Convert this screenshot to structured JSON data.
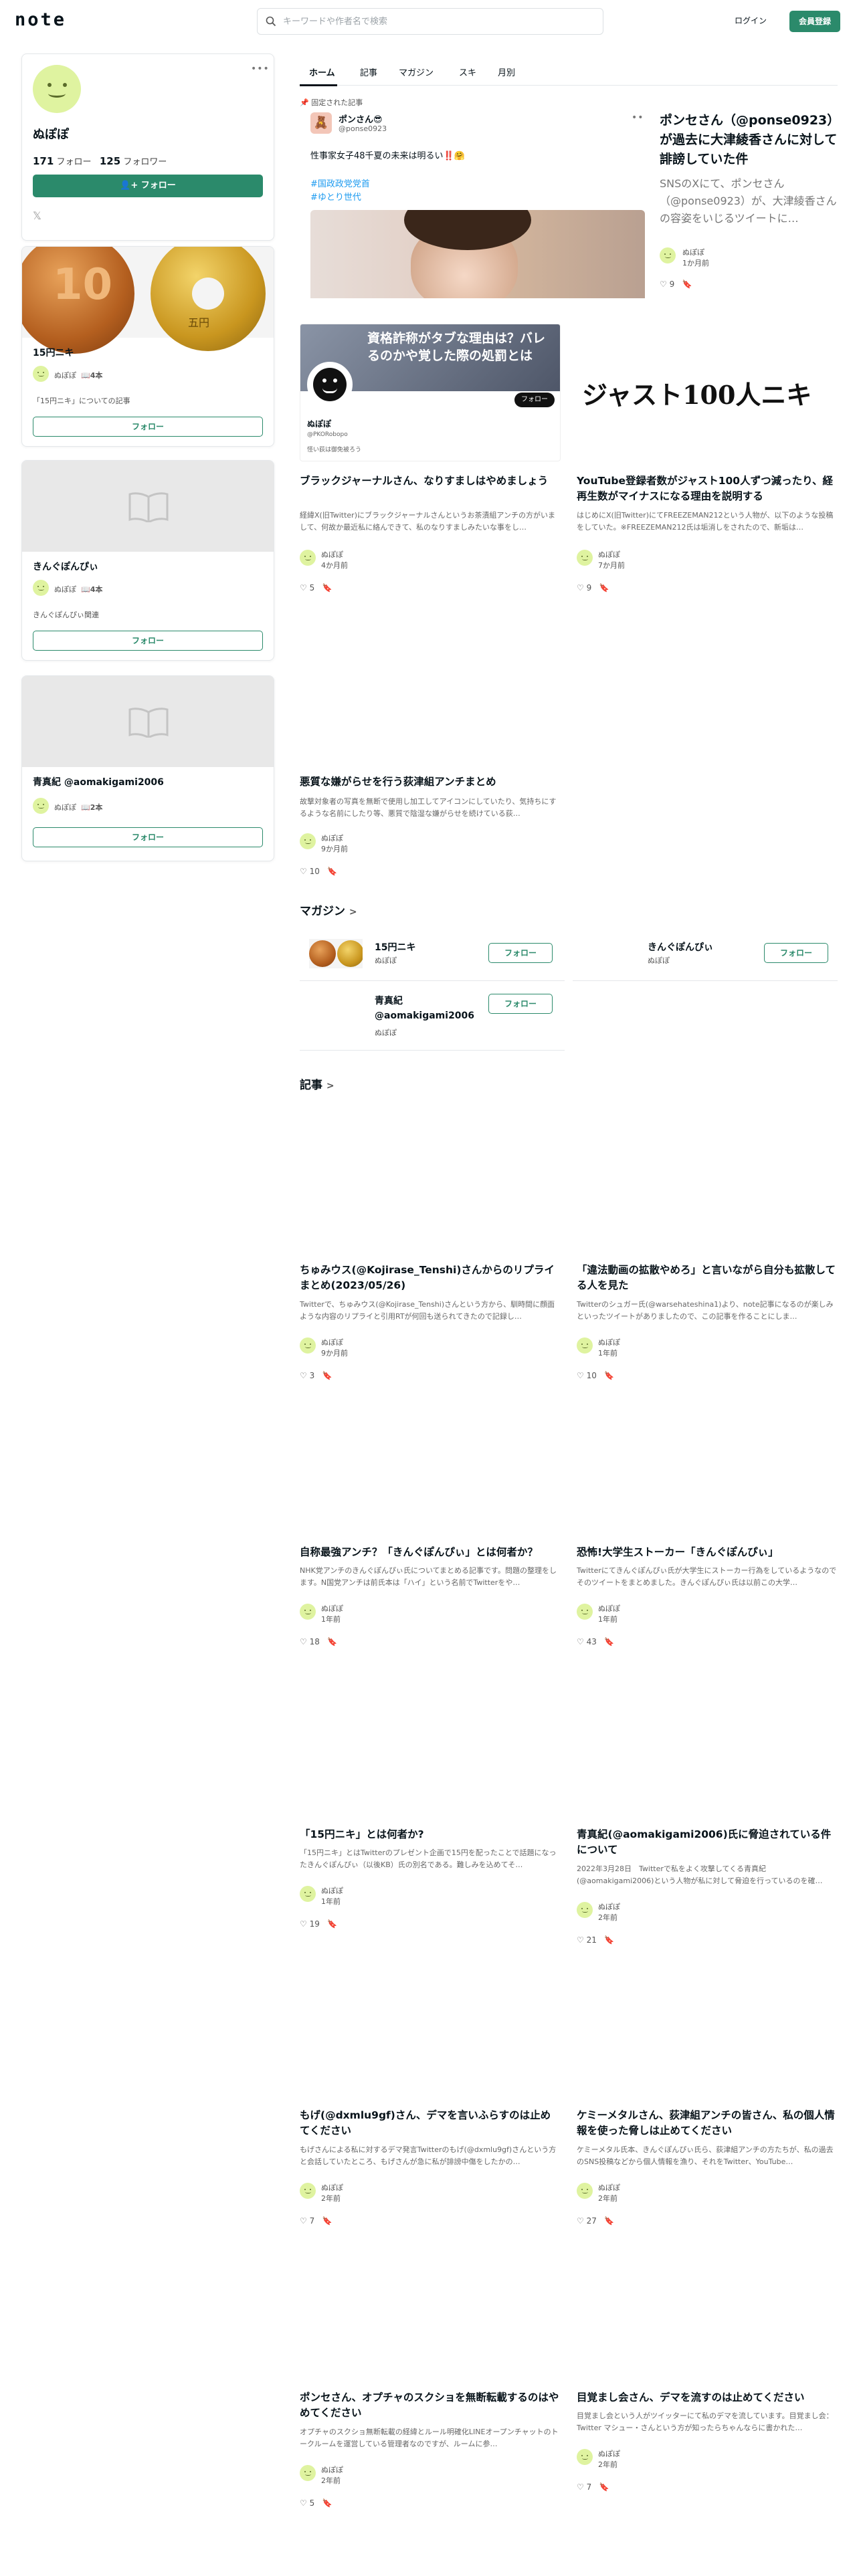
{
  "header": {
    "logo": "note",
    "search_placeholder": "キーワードや作者名で検索",
    "login": "ログイン",
    "signup": "会員登録"
  },
  "profile": {
    "name": "ぬぽぽ",
    "following_count": "171",
    "following_label": "フォロー",
    "followers_count": "125",
    "followers_label": "フォロワー",
    "follow_button": "フォロー"
  },
  "sidebar_magazines": [
    {
      "title": "15円ニキ",
      "author": "ぬぽぽ",
      "count": "4本",
      "description": "「15円ニキ」についての記事",
      "follow": "フォロー"
    },
    {
      "title": "きんぐぽんぴぃ",
      "author": "ぬぽぽ",
      "count": "4本",
      "description": "きんぐぽんぴぃ関連",
      "follow": "フォロー"
    },
    {
      "title": "青真紀 @aomakigami2006",
      "author": "ぬぽぽ",
      "count": "2本",
      "description": "",
      "follow": "フォロー"
    }
  ],
  "tabs": [
    "ホーム",
    "記事",
    "マガジン",
    "スキ",
    "月別"
  ],
  "pinned": {
    "label": "固定された記事",
    "embed_user": "ポンさん😎",
    "embed_handle": "@ponse0923",
    "embed_text": "性事家女子48千夏の未来は明るい‼️🤗",
    "embed_tags": [
      "#国政政党党首",
      "#ゆとり世代"
    ],
    "title": "ポンセさん（@ponse0923）が過去に大津綾香さんに対して誹謗していた件",
    "desc": "SNSのXにて、ポンセさん（@ponse0923）が、大津綾香さんの容姿をいじるツイートに…",
    "author": "ぬぽぽ",
    "time": "1か月前",
    "likes": "9"
  },
  "featured": [
    {
      "title": "ブラックジャーナルさん、なりすましはやめましょう",
      "desc": "経緯X(旧Twitter)にブラックジャーナルさんというお茶漬組アンチの方がいまして、何故か最近私に絡んできて、私のなりすましみたいな事をし…",
      "author": "ぬぽぽ",
      "time": "4か月前",
      "likes": "5",
      "thumb_text": "資格詐称がタブな理由は？バレるのかや覚した際の処罰とは",
      "thumb_name": "ぬぽぽ",
      "thumb_handle": "@PKORobopo",
      "thumb_bio": "怪い荻は御免被ろう",
      "thumb_follow": "フォロー"
    },
    {
      "title": "YouTube登録者数がジャスト100人ずつ減ったり、経再生数がマイナスになる理由を説明する",
      "desc": "はじめにX(旧Twitter)にてFREEZEMAN212という人物が、以下のような投稿をしていた。※FREEZEMAN212氏は垢消しをされたので、新垢は…",
      "author": "ぬぽぽ",
      "time": "7か月前",
      "likes": "9",
      "thumb_text": "ジャスト100人ニキ"
    },
    {
      "title": "悪質な嫌がらせを行う荻津組アンチまとめ",
      "desc": "故撃対象者の写真を無断で使用し加工してアイコンにしていたり、気持ちにするような名前にしたり等、悪質で陰湿な嫌がらせを続けている荻…",
      "author": "ぬぽぽ",
      "time": "9か月前",
      "likes": "10"
    }
  ],
  "magazine_section": {
    "heading": "マガジン",
    "items": [
      {
        "title": "15円ニキ",
        "author": "ぬぽぽ",
        "follow": "フォロー"
      },
      {
        "title": "きんぐぽんぴぃ",
        "author": "ぬぽぽ",
        "follow": "フォロー"
      },
      {
        "title": "青真紀 @aomakigami2006",
        "author": "ぬぽぽ",
        "follow": "フォロー"
      }
    ]
  },
  "articles_section": {
    "heading": "記事",
    "items": [
      {
        "title": "ちゅみウス(@Kojirase_Tenshi)さんからのリプライまとめ(2023/05/26)",
        "desc": "Twitterで、ちゅみウス(@Kojirase_Tenshi)さんという方から、馴時間に顔面ような内容のリプライと引用RTが何回も送られてきたので記録し…",
        "author": "ぬぽぽ",
        "time": "9か月前",
        "likes": "3"
      },
      {
        "title": "「違法動画の拡散やめろ」と言いながら自分も拡散してる人を見た",
        "desc": "Twitterのシュガー氏(@warsehateshina1)より、note記事になるのが楽しみといったツイートがありましたので、この記事を作ることにしま…",
        "author": "ぬぽぽ",
        "time": "1年前",
        "likes": "10"
      },
      {
        "title": "自称最強アンチ？「きんぐぽんぴぃ」とは何者か？",
        "desc": "NHK党アンチのきんぐぽんぴぃ氏についてまとめる記事です。問題の整理をします。N国党アンチは前氏本は「ハイ」という名前でTwitterをや…",
        "author": "ぬぽぽ",
        "time": "1年前",
        "likes": "18"
      },
      {
        "title": "恐怖!大学生ストーカー「きんぐぽんぴぃ」",
        "desc": "Twitterにてきんぐぽんぴぃ氏が大学生にストーカー行為をしているようなのでそのツイートをまとめました。きんぐぽんぴぃ氏は以前この大学…",
        "author": "ぬぽぽ",
        "time": "1年前",
        "likes": "43"
      },
      {
        "title": "「15円ニキ」とは何者か?",
        "desc": "「15円ニキ」とはTwitterのプレゼント企画で15円を配ったことで話題になったきんぐぽんぴぃ（以後KB）氏の別名である。難しみを込めてそ…",
        "author": "ぬぽぽ",
        "time": "1年前",
        "likes": "19"
      },
      {
        "title": "青真紀(@aomakigami2006)氏に脅迫されている件について",
        "desc": "2022年3月28日　Twitterで私をよく攻撃してくる青真紀(@aomakigami2006)という人物が私に対して脅迫を行っているのを確…",
        "author": "ぬぽぽ",
        "time": "2年前",
        "likes": "21"
      },
      {
        "title": "もげ(@dxmlu9gf)さん、デマを言いふらすのは止めてください",
        "desc": "もげさんによる私に対するデマ発言Twitterのもげ(@dxmlu9gf)さんという方と会話していたところ、もげさんが急に私が誹謗中傷をしたかの…",
        "author": "ぬぽぽ",
        "time": "2年前",
        "likes": "7"
      },
      {
        "title": "ケミーメタルさん、荻津組アンチの皆さん、私の個人情報を使った脅しは止めてください",
        "desc": "ケミーメタル氏本、きんぐぽんぴぃ氏ら、荻津組アンチの方たちが、私の過去のSNS投稿などから個人情報を漁り、それをTwitter、YouTube…",
        "author": "ぬぽぽ",
        "time": "2年前",
        "likes": "27"
      },
      {
        "title": "ポンセさん、オプチャのスクショを無断転載するのはやめてください",
        "desc": "オプチャのスクショ無断転載の経緯とルール明確化LINEオープンチャットのトークルームを運営している管理者なのですが、ルームに参…",
        "author": "ぬぽぽ",
        "time": "2年前",
        "likes": "5"
      },
      {
        "title": "目覚まし会さん、デマを流すのは止めてください",
        "desc": "目覚まし会という人がツイッターにて私のデマを流しています。目覚まし会：Twitter マシュー・さんという方が知ったらちゃんならに書かれた…",
        "author": "ぬぽぽ",
        "time": "2年前",
        "likes": "7"
      }
    ]
  },
  "colors": {
    "accent": "#2b8a6b",
    "text": "#08131a",
    "muted": "#666666",
    "border": "#e4e7ea"
  }
}
